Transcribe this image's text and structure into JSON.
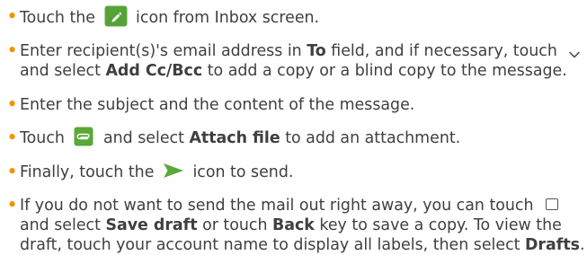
{
  "steps": [
    {
      "lines": [
        {
          "t1": "Touch the",
          "t2": "icon from Inbox screen."
        }
      ]
    },
    {
      "lines": [
        {
          "t1": "Enter recipient(s)'s email address in",
          "b1": "To",
          "t2": "field, and if necessary, touch"
        },
        {
          "b1": "and select",
          "b2": "Add Cc/Bcc",
          "t1": "to add a copy or a blind copy to the message."
        }
      ]
    },
    {
      "lines": [
        {
          "t1": "Enter the subject and the content of the message."
        }
      ]
    },
    {
      "lines": [
        {
          "t1": "Touch",
          "t2": "and select",
          "b1": "Attach file",
          "t3": "to add an attachment."
        }
      ]
    },
    {
      "lines": [
        {
          "t1": "Finally, touch the",
          "t2": "icon to send."
        }
      ]
    },
    {
      "lines": [
        {
          "t1": "If you do not want to send the mail out right away, you can touch"
        },
        {
          "t1": "and select",
          "b1": "Save draft",
          "t2": "or touch",
          "b2": "Back",
          "t3": "key to save a copy. To view the"
        },
        {
          "t1": "draft, touch your account name to display all labels, then select",
          "b1": "Drafts",
          "t2": "."
        }
      ]
    }
  ],
  "bullet_char": "•",
  "icons": {
    "compose": "compose-icon",
    "dropdown": "chevron-down-icon",
    "attach": "paperclip-icon",
    "send": "send-icon",
    "more": "checkbox-icon"
  },
  "colors": {
    "text": "#3f3f3f",
    "bullet": "#f29400",
    "icon_fill": "#5aa83a"
  }
}
